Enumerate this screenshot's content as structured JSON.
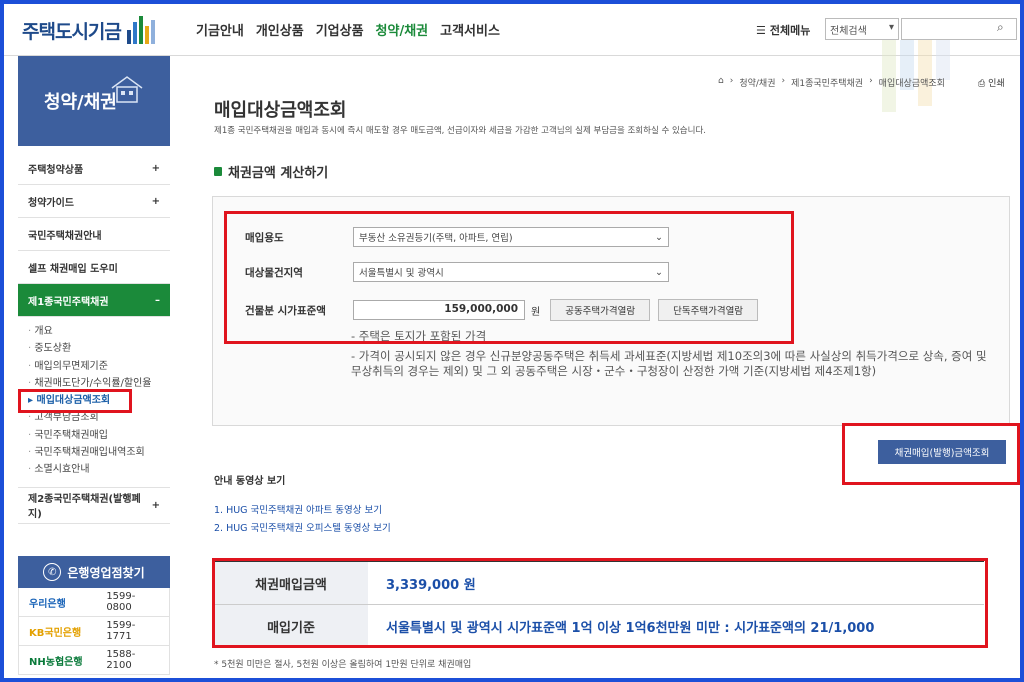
{
  "header": {
    "logo": "주택도시기금",
    "nav": [
      "기금안내",
      "개인상품",
      "기업상품",
      "청약/채권",
      "고객서비스"
    ],
    "active_nav": "청약/채권",
    "allmenu": "전체메뉴",
    "search_select": "전체검색",
    "search_placeholder": ""
  },
  "sidebar": {
    "banner": "청약/채권",
    "items": [
      {
        "label": "주택청약상품",
        "sign": "+"
      },
      {
        "label": "청약가이드",
        "sign": "+"
      },
      {
        "label": "국민주택채권안내",
        "sign": ""
      },
      {
        "label": "셀프 채권매입 도우미",
        "sign": ""
      },
      {
        "label": "제1종국민주택채권",
        "sign": "–"
      }
    ],
    "sub_items": [
      "개요",
      "중도상환",
      "매입의무면제기준",
      "채권매도단가/수익률/할인율",
      "매입대상금액조회",
      "고객부담금조회",
      "국민주택채권매입",
      "국민주택채권매입내역조회",
      "소멸시효안내"
    ],
    "current_sub": "매입대상금액조회",
    "item_after": {
      "label": "제2종국민주택채권(발행폐지)",
      "sign": "+"
    },
    "bank_title": "은행영업점찾기",
    "banks": [
      {
        "name": "우리은행",
        "tel": "1599-0800",
        "color": "#1a64b8"
      },
      {
        "name": "KB국민은행",
        "tel": "1599-1771",
        "color": "#e3a000"
      },
      {
        "name": "NH농협은행",
        "tel": "1588-2100",
        "color": "#0a7a3a"
      }
    ]
  },
  "content": {
    "breadcrumb": [
      "⌂",
      "청약/채권",
      "제1종국민주택채권",
      "매입대상금액조회"
    ],
    "print": "인쇄",
    "title": "매입대상금액조회",
    "description": "제1종 국민주택채권을 매입과 동시에 즉시 매도할 경우 매도금액, 선급이자와 세금을 가감한 고객님의 실제 부담금을 조회하실 수 있습니다.",
    "section_title": "채권금액 계산하기",
    "form": {
      "purpose_label": "매입용도",
      "purpose_value": "부동산 소유권등기(주택, 아파트, 연립)",
      "region_label": "대상물건지역",
      "region_value": "서울특별시 및 광역시",
      "price_label": "건물분 시가표준액",
      "price_value": "159,000,000",
      "unit": "원",
      "btn_apt": "공동주택가격열람",
      "btn_house": "단독주택가격열람",
      "note1": "- 주택은 토지가 포함된 가격",
      "note2": "- 가격이 공시되지 않은 경우 신규분양공동주택은 취득세 과세표준(지방세법 제10조의3에 따른 사실상의 취득가격으로 상속, 증여 및 무상취득의 경우는 제외) 및 그 외 공동주택은 시장・군수・구청장이 산정한 가액 기준(지방세법 제4조제1항)"
    },
    "submit_label": "채권매입(발행)금액조회",
    "video_title": "안내 동영상 보기",
    "video_links": [
      "1. HUG 국민주택채권 아파트 동영상 보기",
      "2. HUG 국민주택채권 오피스텔 동영상 보기"
    ],
    "result": {
      "amount_label": "채권매입금액",
      "amount_value": "3,339,000 원",
      "basis_label": "매입기준",
      "basis_value": "서울특별시 및 광역시 시가표준액 1억 이상 1억6천만원 미만 : 시가표준액의 21/1,000"
    },
    "footnote": "* 5천원 미만은 절사, 5천원 이상은 올림하여 1만원 단위로 채권매입"
  },
  "colors": {
    "brand_blue": "#3d5f9e",
    "active_green": "#1b8a3a",
    "highlight_red": "#e0141e",
    "frame_blue": "#1c4fd8"
  }
}
